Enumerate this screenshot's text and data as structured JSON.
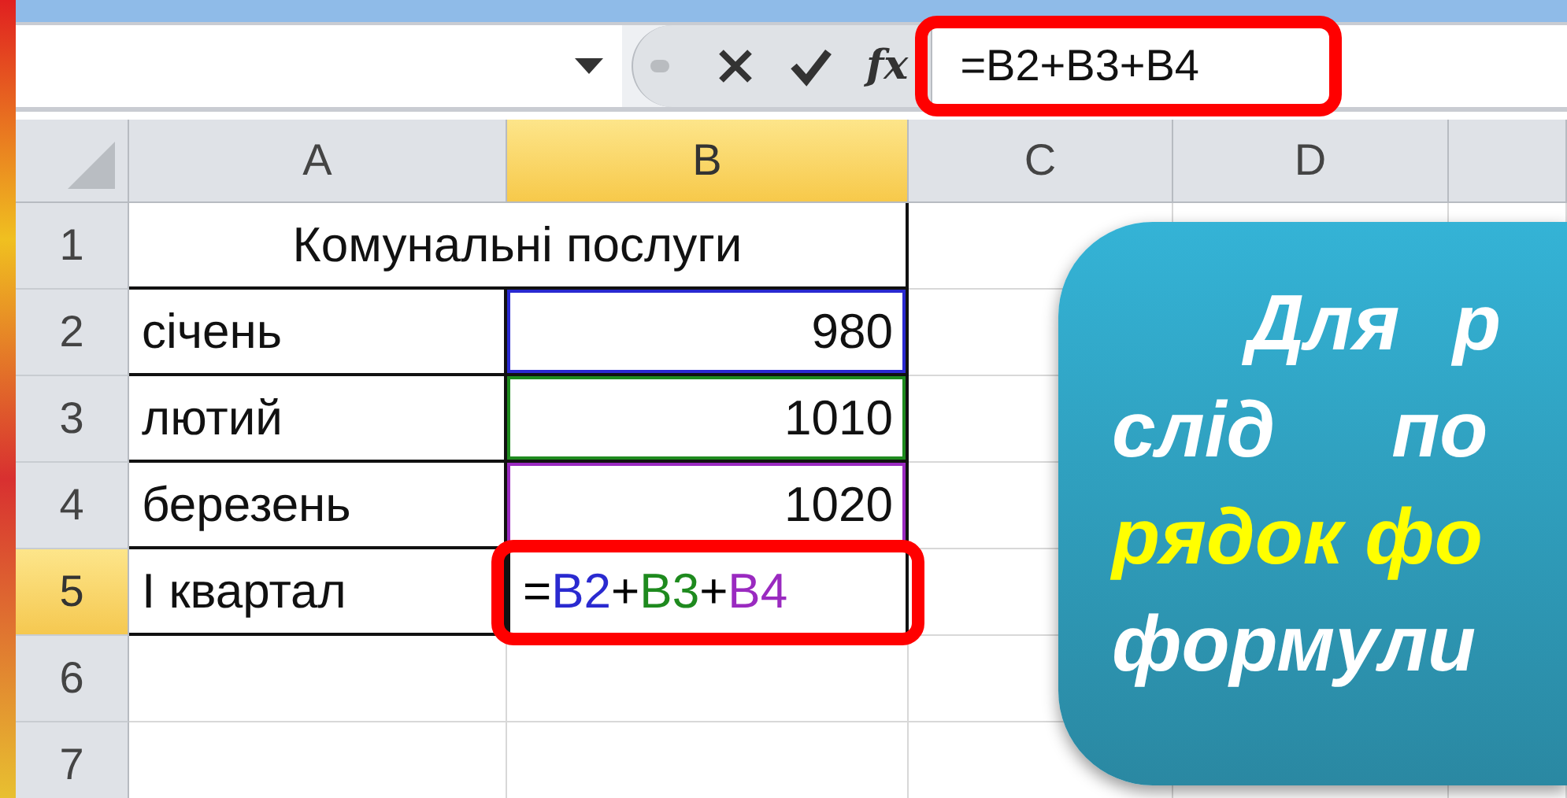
{
  "formula_bar": {
    "function_label": "fx",
    "value": "=B2+B3+B4",
    "highlighted": true
  },
  "columns": [
    {
      "label": "A",
      "selected": false
    },
    {
      "label": "B",
      "selected": true
    },
    {
      "label": "C",
      "selected": false
    },
    {
      "label": "D",
      "selected": false
    }
  ],
  "rows": [
    {
      "number": "1",
      "selected": false,
      "title": "Комунальні послуги"
    },
    {
      "number": "2",
      "selected": false,
      "label": "січень",
      "value": "980",
      "color": "#2a2ad0"
    },
    {
      "number": "3",
      "selected": false,
      "label": "лютий",
      "value": "1010",
      "color": "#1e8a1e"
    },
    {
      "number": "4",
      "selected": false,
      "label": "березень",
      "value": "1020",
      "color": "#9a2ac0"
    },
    {
      "number": "5",
      "selected": true,
      "label": "І квартал",
      "formula": [
        {
          "text": "=",
          "color": "#000000"
        },
        {
          "text": "B2",
          "color": "#2a2ad0"
        },
        {
          "text": "+",
          "color": "#000000"
        },
        {
          "text": "B3",
          "color": "#1e8a1e"
        },
        {
          "text": "+",
          "color": "#000000"
        },
        {
          "text": "B4",
          "color": "#9a2ac0"
        }
      ],
      "highlighted": true
    },
    {
      "number": "6",
      "selected": false
    },
    {
      "number": "7",
      "selected": false
    }
  ],
  "callout": {
    "lines": [
      {
        "text": "Для р",
        "highlighted": false
      },
      {
        "text": "слід по",
        "highlighted": false
      },
      {
        "text": "рядок фо",
        "highlighted": true
      },
      {
        "text": "формули",
        "highlighted": false
      }
    ]
  }
}
